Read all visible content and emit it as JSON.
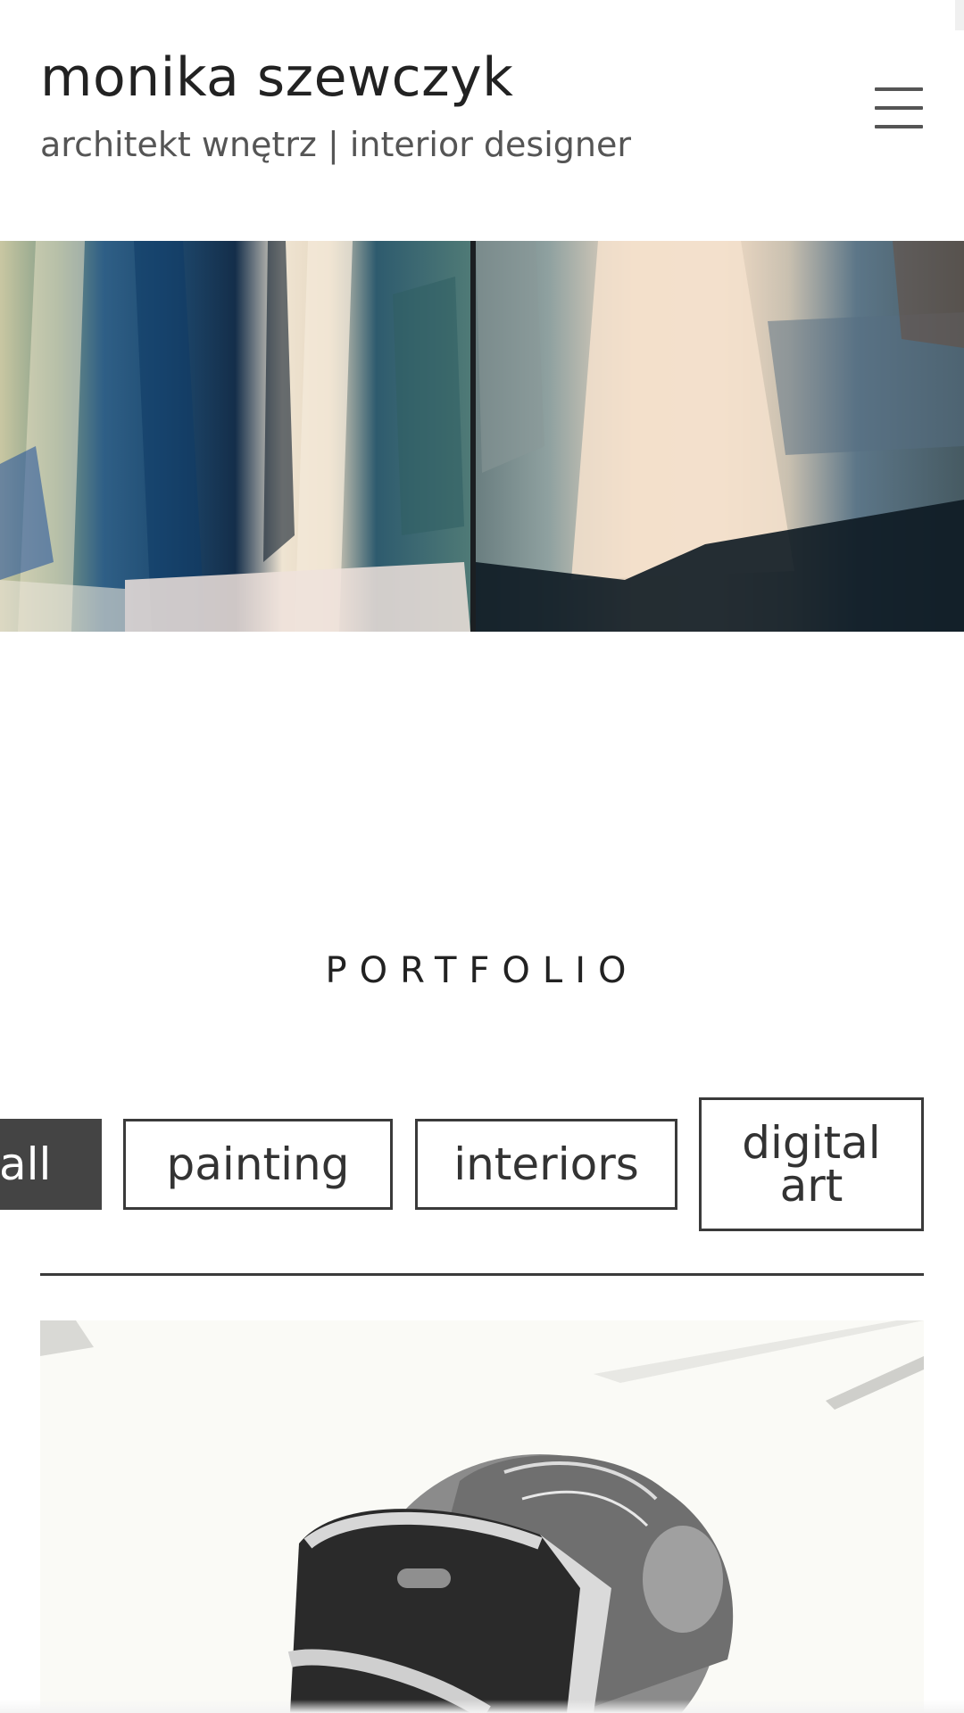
{
  "header": {
    "title": "monika szewczyk",
    "subtitle": "architekt wnętrz | interior designer",
    "menu_icon": "hamburger-menu-icon"
  },
  "hero": {
    "image_description_icon": "hero-painting-diptych-image"
  },
  "portfolio": {
    "heading": "PORTFOLIO",
    "filters": [
      {
        "label": "all",
        "active": true
      },
      {
        "label": "painting",
        "active": false
      },
      {
        "label": "interiors",
        "active": false
      },
      {
        "label_line1": "digital",
        "label_line2": "art",
        "active": false
      }
    ],
    "first_item_icon": "vr-headset-portrait-image"
  },
  "colors": {
    "text_dark": "#222222",
    "text_muted": "#555555",
    "active_filter_bg": "#444444",
    "border": "#3a3a3a",
    "background": "#ffffff"
  }
}
